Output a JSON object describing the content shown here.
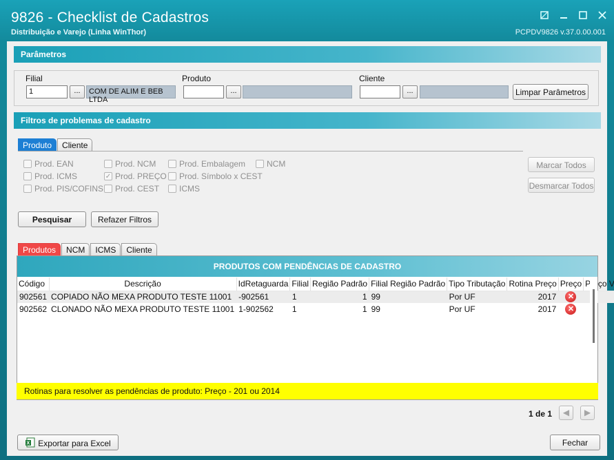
{
  "window": {
    "title": "9826 - Checklist de Cadastros",
    "subtitle": "Distribuição e Varejo (Linha WinThor)",
    "version": "PCPDV9826  v.37.0.00.001"
  },
  "parametros": {
    "header": "Parâmetros",
    "filial": {
      "label": "Filial",
      "value": "1",
      "description": "COM DE ALIM E BEB LTDA"
    },
    "produto": {
      "label": "Produto",
      "value": "",
      "description": ""
    },
    "cliente": {
      "label": "Cliente",
      "value": "",
      "description": ""
    },
    "browse_label": "...",
    "clear_button": "Limpar Parâmetros"
  },
  "filtros": {
    "header": "Filtros de problemas de cadastro",
    "tabs": [
      "Produto",
      "Cliente"
    ],
    "checkboxes": [
      {
        "label": "Prod. EAN",
        "checked": false
      },
      {
        "label": "Prod. ICMS",
        "checked": false
      },
      {
        "label": "Prod. PIS/COFINS",
        "checked": false
      },
      {
        "label": "Prod. NCM",
        "checked": false
      },
      {
        "label": "Prod. PREÇO",
        "checked": true
      },
      {
        "label": "Prod. CEST",
        "checked": false
      },
      {
        "label": "Prod. Embalagem",
        "checked": false
      },
      {
        "label": "Prod. Símbolo x CEST",
        "checked": false
      },
      {
        "label": "ICMS",
        "checked": false
      },
      {
        "label": "NCM",
        "checked": false
      }
    ],
    "mark_all": "Marcar Todos",
    "unmark_all": "Desmarcar Todos"
  },
  "actions": {
    "search": "Pesquisar",
    "redo_filters": "Refazer Filtros"
  },
  "results": {
    "tabs": [
      "Produtos",
      "NCM",
      "ICMS",
      "Cliente"
    ],
    "title": "PRODUTOS COM PENDÊNCIAS DE CADASTRO",
    "columns": [
      "Código",
      "Descrição",
      "IdRetaguarda",
      "Filial",
      "Região Padrão",
      "Filial Região Padrão",
      "Tipo Tributação",
      "Rotina Preço",
      "Preço",
      "Preço Venda"
    ],
    "rows": [
      {
        "codigo": "902561",
        "descricao": "COPIADO NÃO MEXA PRODUTO TESTE 11001",
        "idretaguarda": "-902561",
        "filial": "1",
        "regiao": "1",
        "filial_regiao": "99",
        "tipo": "Por UF",
        "rotina": "2017",
        "preco_status": "error-icon",
        "preco_venda": ""
      },
      {
        "codigo": "902562",
        "descricao": "CLONADO NÃO MEXA PRODUTO TESTE 11001",
        "idretaguarda": "1-902562",
        "filial": "1",
        "regiao": "1",
        "filial_regiao": "99",
        "tipo": "Por UF",
        "rotina": "2017",
        "preco_status": "error-icon",
        "preco_venda": ""
      }
    ],
    "hint": "Rotinas para resolver as pendências de produto: Preço - 201 ou 2014",
    "page": "1 de 1"
  },
  "footer": {
    "export": "Exportar para Excel",
    "close": "Fechar"
  },
  "colors": {
    "accent": "#1aa2b8",
    "active_tab_blue": "#1d7fd4",
    "active_tab_red": "#f04747",
    "hint_bg": "#ffff00"
  }
}
